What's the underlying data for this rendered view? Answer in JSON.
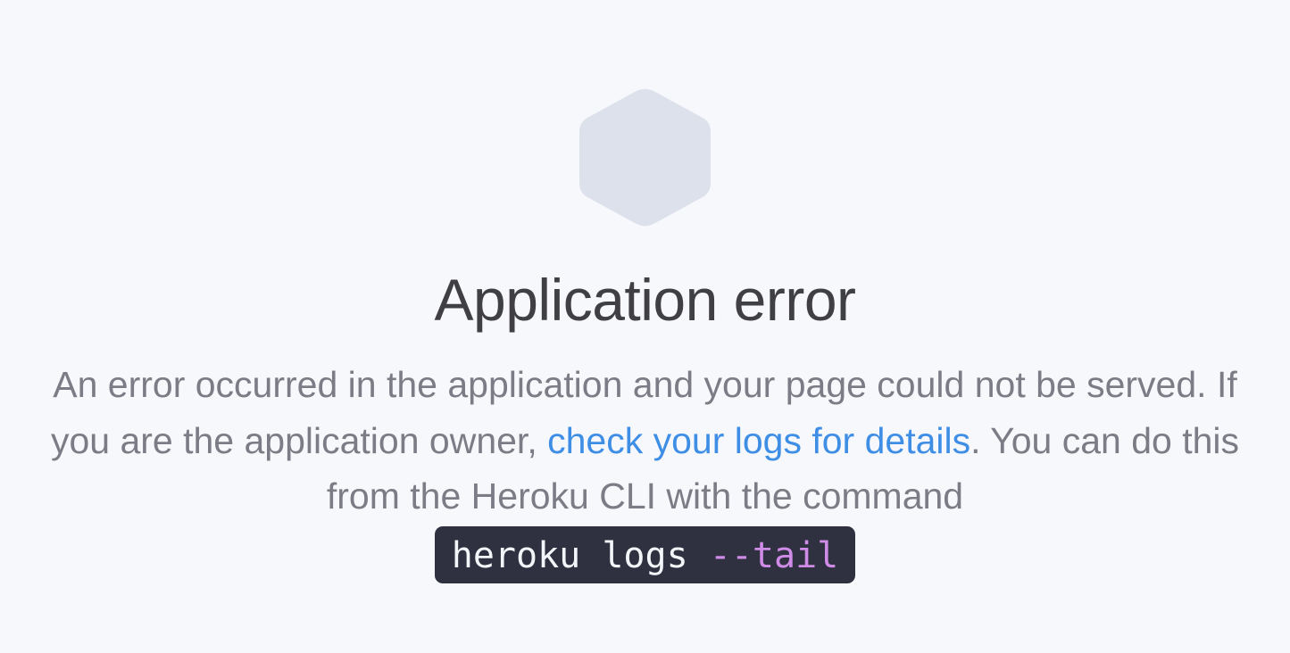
{
  "error": {
    "title": "Application error",
    "message_before_link": "An error occurred in the application and your page could not be served. If you are the application owner, ",
    "link_text": "check your logs for details",
    "message_after_link": ". You can do this from the Heroku CLI with the command",
    "command_base": "heroku logs ",
    "command_flag": "--tail"
  },
  "icon": {
    "name": "hexagon-icon",
    "color": "#dce1ec"
  },
  "colors": {
    "background": "#f7f8fb",
    "title": "#3f3f44",
    "text": "#7c7c86",
    "link": "#3e8ee6",
    "command_bg": "#2f3140",
    "command_flag": "#cf8be6"
  }
}
